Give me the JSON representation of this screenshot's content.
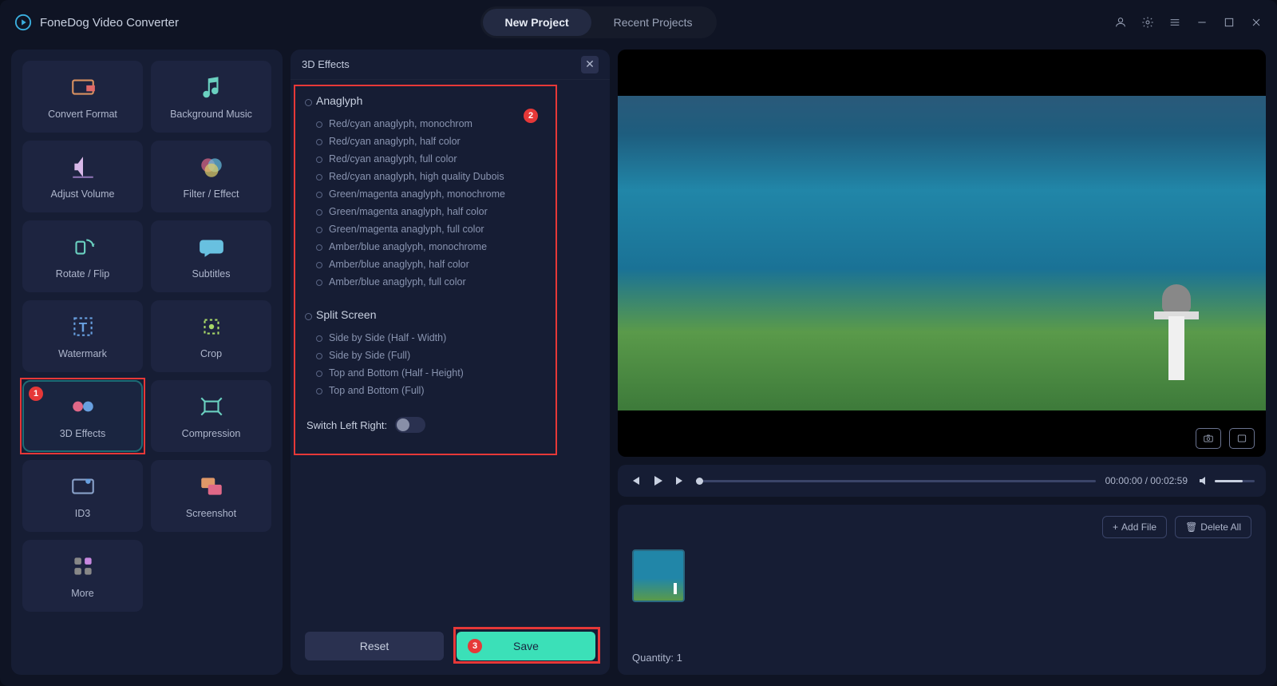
{
  "app": {
    "title": "FoneDog Video Converter"
  },
  "tabs": {
    "new_project": "New Project",
    "recent_projects": "Recent Projects"
  },
  "sidebar": {
    "tools": [
      {
        "label": "Convert Format"
      },
      {
        "label": "Background Music"
      },
      {
        "label": "Adjust Volume"
      },
      {
        "label": "Filter / Effect"
      },
      {
        "label": "Rotate / Flip"
      },
      {
        "label": "Subtitles"
      },
      {
        "label": "Watermark"
      },
      {
        "label": "Crop"
      },
      {
        "label": "3D Effects"
      },
      {
        "label": "Compression"
      },
      {
        "label": "ID3"
      },
      {
        "label": "Screenshot"
      },
      {
        "label": "More"
      }
    ]
  },
  "center": {
    "title": "3D Effects",
    "groups": {
      "anaglyph": {
        "title": "Anaglyph",
        "options": [
          "Red/cyan anaglyph, monochrom",
          "Red/cyan anaglyph, half color",
          "Red/cyan anaglyph, full color",
          "Red/cyan anaglyph, high quality Dubois",
          "Green/magenta anaglyph, monochrome",
          "Green/magenta anaglyph, half color",
          "Green/magenta anaglyph, full color",
          "Amber/blue anaglyph, monochrome",
          "Amber/blue anaglyph, half color",
          "Amber/blue anaglyph, full color"
        ]
      },
      "split": {
        "title": "Split Screen",
        "options": [
          "Side by Side (Half - Width)",
          "Side by Side (Full)",
          "Top and Bottom (Half - Height)",
          "Top and Bottom (Full)"
        ]
      }
    },
    "switch_label": "Switch Left Right:",
    "reset": "Reset",
    "save": "Save"
  },
  "player": {
    "time": "00:00:00 / 00:02:59"
  },
  "files": {
    "add_file": "Add File",
    "delete_all": "Delete All",
    "quantity_label": "Quantity:",
    "quantity_value": "1"
  },
  "markers": {
    "m1": "1",
    "m2": "2",
    "m3": "3"
  }
}
